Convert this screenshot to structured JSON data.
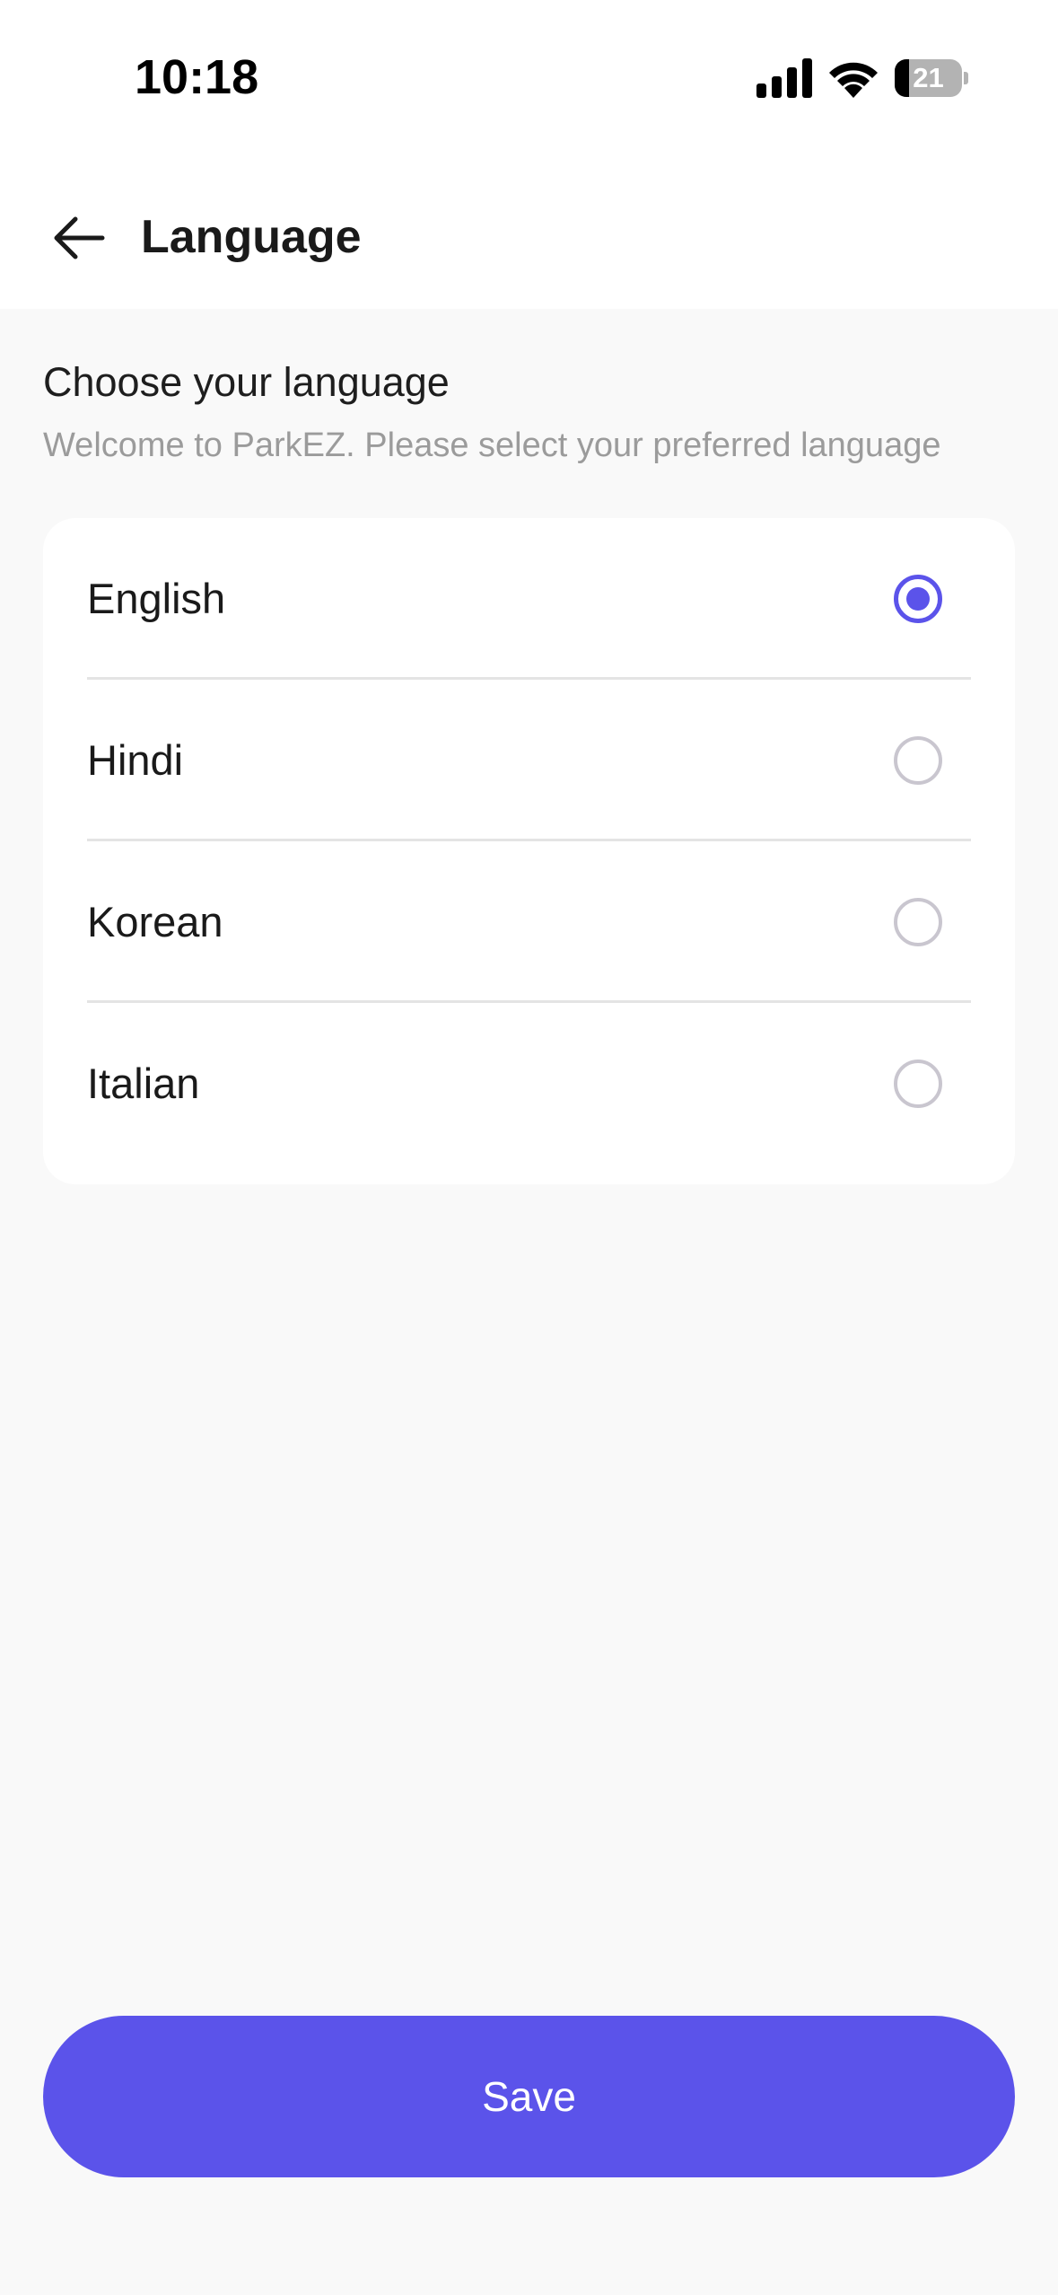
{
  "status_bar": {
    "time": "10:18",
    "battery_level": "21",
    "battery_fraction": 0.21,
    "icons": [
      "signal-icon",
      "wifi-icon",
      "battery-icon"
    ]
  },
  "header": {
    "title": "Language",
    "back_icon": "arrow-left-icon"
  },
  "intro": {
    "heading": "Choose your language",
    "subtitle": "Welcome to ParkEZ. Please select your preferred language"
  },
  "languages": {
    "items": [
      {
        "label": "English",
        "selected": true
      },
      {
        "label": "Hindi",
        "selected": false
      },
      {
        "label": "Korean",
        "selected": false
      },
      {
        "label": "Italian",
        "selected": false
      }
    ]
  },
  "footer": {
    "save_label": "Save"
  },
  "colors": {
    "accent": "#5b53ea",
    "background": "#f9f9f9",
    "card": "#ffffff",
    "muted_text": "#9b9b9b",
    "radio_border": "#c9c6cf"
  }
}
